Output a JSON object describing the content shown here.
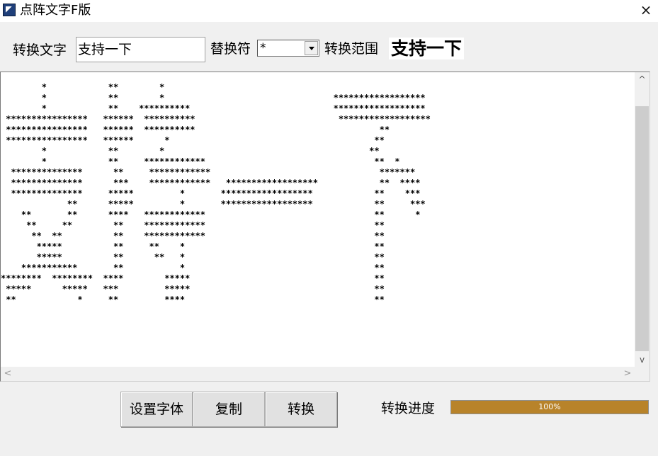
{
  "window": {
    "title": "点阵文字F版",
    "close_glyph": "×"
  },
  "form": {
    "text_label": "转换文字",
    "text_value": "支持一下",
    "char_label": "替换符",
    "char_value": "*",
    "range_label": "转换范围",
    "range_preview": "支持一下"
  },
  "output": {
    "lines": [
      "        *            **        *",
      "        *            **        *                                 ******************",
      "        *            **    **********                            ******************",
      " ****************   ******  **********                            ******************",
      " ****************   ******  **********                                    **",
      " ****************   ******      *                                        **",
      "        *            **        *                                        **",
      "        *            **     ************                                 **  *",
      "  **************      **     ************                                 *******",
      "  **************      ***    ************   ******************            **  ****",
      "  **************     *****         *       ******************            **    ***",
      "             **      *****         *       ******************            **     ***",
      "    **       **      ****   ************                                 **      *",
      "     **     **        **    ************                                 **",
      "      **  **          **    ************                                 **",
      "       *****          **     **    *                                     **",
      "       *****          **      **   *                                     **",
      "    ***********       **           *                                     **",
      "********  ********  ****        *****                                    **",
      " *****      *****   ***         *****                                    **",
      " **            *     **         ****                                     **"
    ],
    "scroll_up": "^",
    "scroll_down": "v",
    "scroll_left": "<",
    "scroll_right": ">"
  },
  "buttons": {
    "set_font": "设置字体",
    "copy": "复制",
    "convert": "转换"
  },
  "progress": {
    "label": "转换进度",
    "value": 1.0,
    "text": "100%",
    "color": "#b8832a"
  }
}
